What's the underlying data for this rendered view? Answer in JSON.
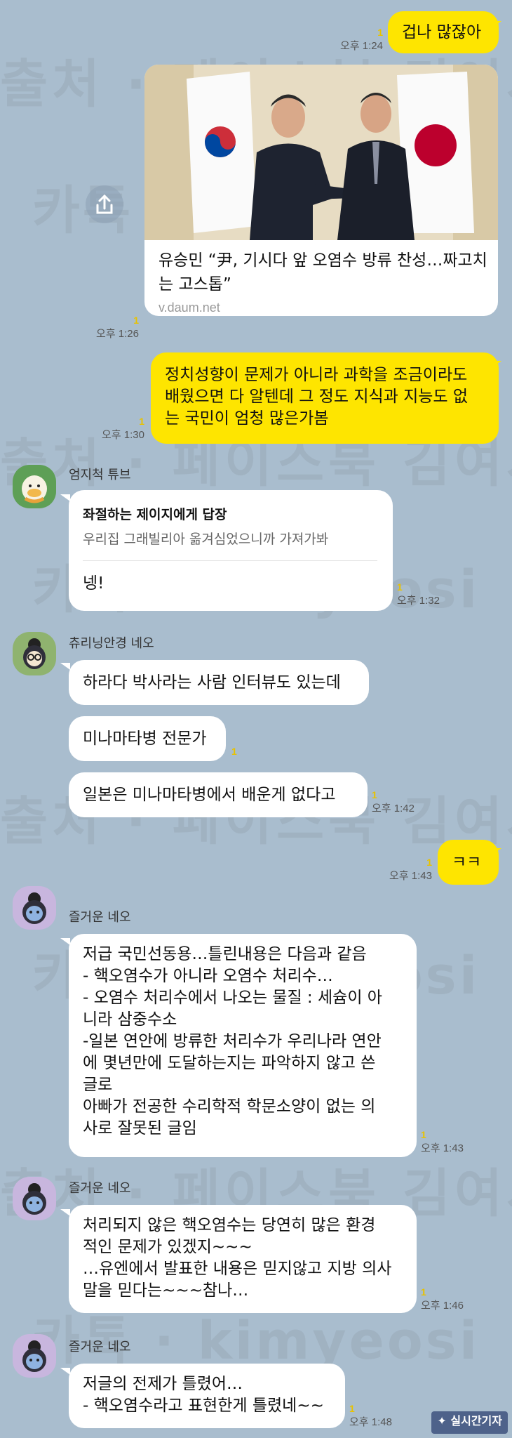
{
  "watermarks": {
    "source": "출처 · 페이스북 김여시",
    "kakao": "카톡 · kimyeosi"
  },
  "messages": {
    "m1": {
      "text": "겁나 많잖아",
      "time": "오후 1:24",
      "unread": "1"
    },
    "m2": {
      "title": "유승민 “尹, 기시다 앞 오염수 방류 찬성…짜고치는 고스톱”",
      "domain": "v.daum.net",
      "time": "오후 1:26",
      "unread": "1"
    },
    "m3": {
      "lines": [
        "정치성향이 문제가 아니라 과학을 조금이라도",
        "배웠으면 다 알텐데 그 정도 지식과 지능도 없",
        "는 국민이 엄청 많은가봄"
      ],
      "time": "오후 1:30",
      "unread": "1"
    },
    "m4": {
      "sender": "엄지척 튜브",
      "reply_title": "좌절하는 제이지에게 답장",
      "reply_quote": "우리집  그래빌리아 옮겨심었으니까 가져가봐",
      "text": "넹!",
      "time": "오후 1:32",
      "unread": "1"
    },
    "m5": {
      "sender": "츄리닝안경 네오",
      "a": "하라다 박사라는 사람 인터뷰도 있는데",
      "b": "미나마타병 전문가",
      "c": "일본은 미나마타병에서 배운게 없다고",
      "b_unread": "1",
      "time": "오후 1:42",
      "unread": "1"
    },
    "m6": {
      "text": "ㅋㅋ",
      "time": "오후 1:43",
      "unread": "1"
    },
    "m7": {
      "sender": "즐거운 네오",
      "lines": [
        "저급 국민선동용…틀린내용은 다음과 같음",
        "- 핵오염수가 아니라 오염수 처리수…",
        "- 오염수 처리수에서 나오는 물질 : 세슘이  아",
        "니라 삼중수소",
        "-일본 연안에 방류한 처리수가 우리나라 연안",
        "에 몇년만에 도달하는지는 파악하지 않고 쓴",
        "글로",
        "아빠가 전공한 수리학적 학문소양이 없는 의",
        "사로 잘못된 글임"
      ],
      "time": "오후 1:43",
      "unread": "1"
    },
    "m8": {
      "sender": "즐거운 네오",
      "lines": [
        "처리되지 않은 핵오염수는 당연히 많은 환경",
        "적인 문제가 있겠지~~~",
        "…유엔에서 발표한 내용은 믿지않고 지방 의사",
        "말을  믿다는~~~참나…"
      ],
      "time": "오후 1:46",
      "unread": "1"
    },
    "m9": {
      "sender": "즐거운 네오",
      "lines": [
        "저글의 전제가 틀렸어…",
        "- 핵오염수라고 표현한게 틀렸네~~"
      ],
      "time": "오후 1:48",
      "unread": "1"
    }
  },
  "logo": "실시간기자",
  "colors": {
    "background": "#a9bdce",
    "my_bubble": "#fee500",
    "other_bubble": "#ffffff",
    "unread": "#e8c200"
  }
}
